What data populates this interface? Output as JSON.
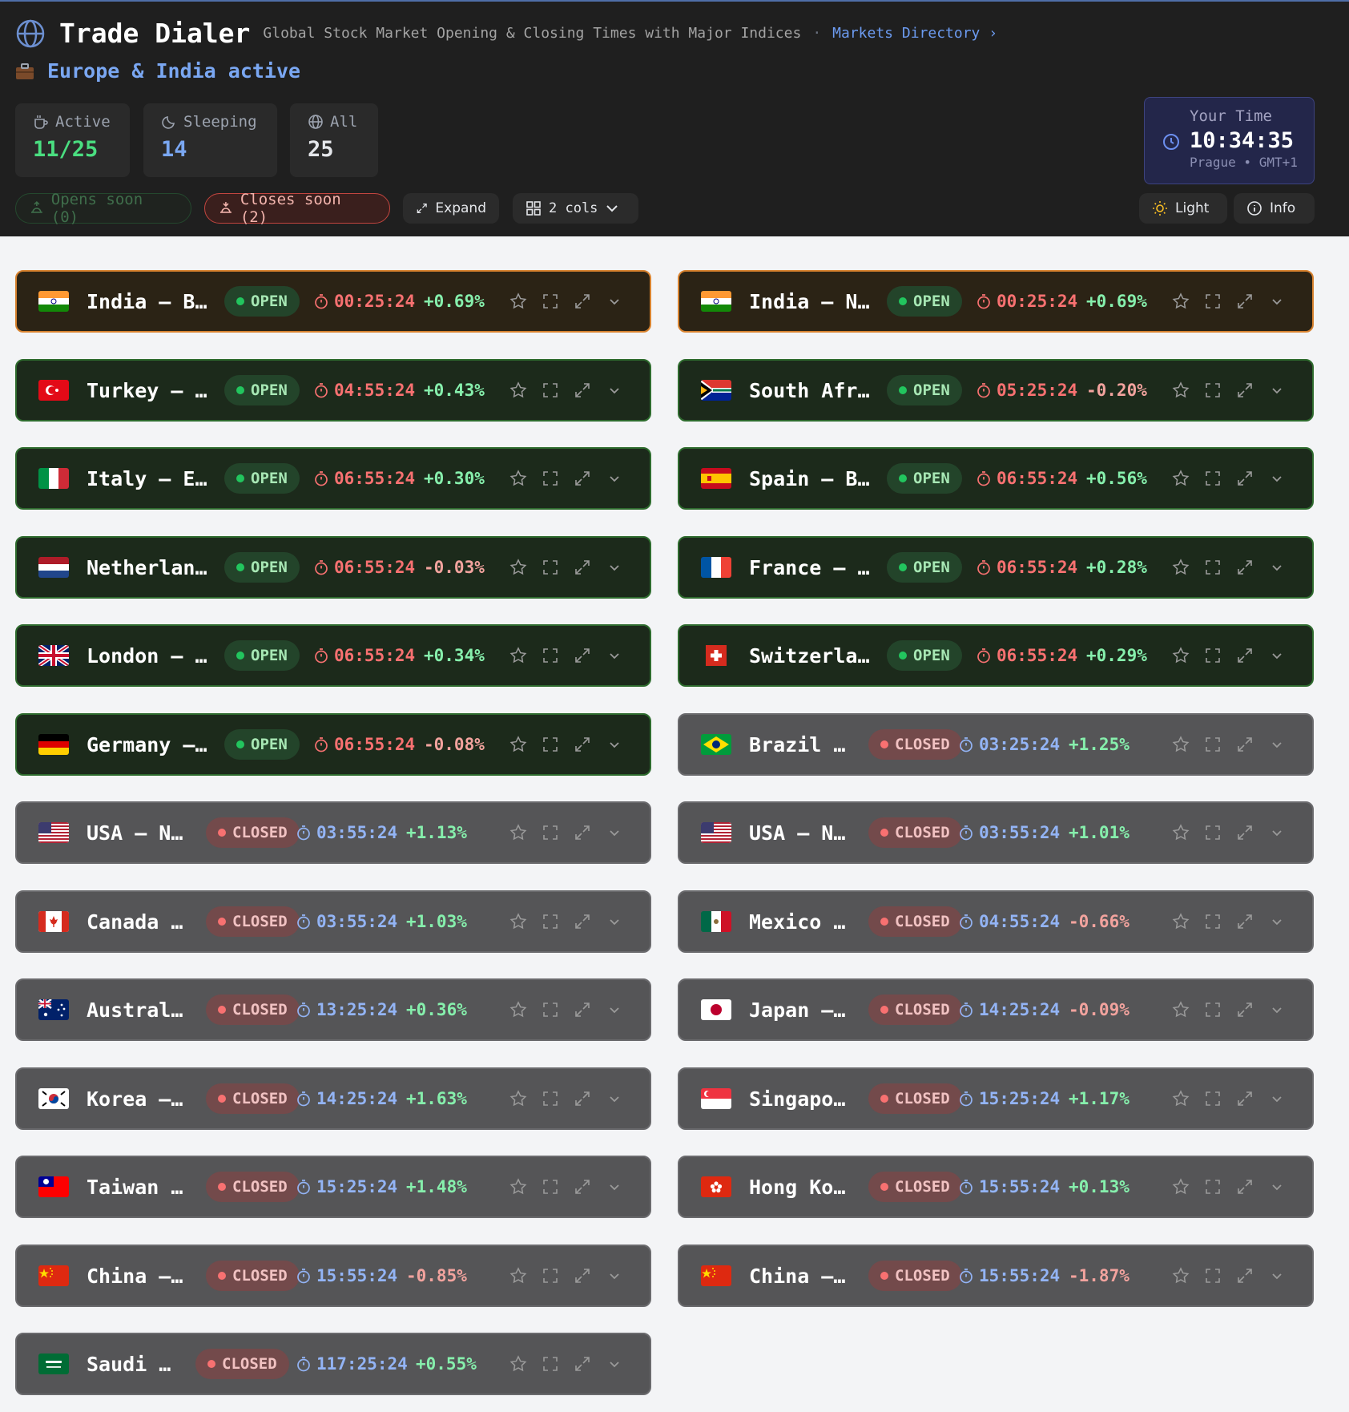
{
  "header": {
    "brand": "Trade Dialer",
    "subtitle": "Global Stock Market Opening & Closing Times with Major Indices",
    "separator": "·",
    "directory_link": "Markets Directory ›",
    "active_regions": "Europe & India active"
  },
  "stats": {
    "active": {
      "label": "Active",
      "value": "11/25"
    },
    "sleeping": {
      "label": "Sleeping",
      "value": "14"
    },
    "all": {
      "label": "All",
      "value": "25"
    }
  },
  "your_time": {
    "label": "Your Time",
    "time": "10:34:35",
    "zone": "Prague • GMT+1"
  },
  "filters": {
    "opens_soon": "Opens soon (0)",
    "closes_soon": "Closes soon (2)"
  },
  "controls": {
    "expand": "Expand",
    "columns": "2 cols",
    "theme": "Light",
    "info": "Info"
  },
  "colors": {
    "open": "#22c55e",
    "closed": "#f87171",
    "accent": "#7aa7f2",
    "closes_soon_border": "#d7822f"
  },
  "markets": [
    {
      "name": "India – B…",
      "flag": "india",
      "status": "OPEN",
      "timer": "00:25:24",
      "change": "+0.69%",
      "soon": true
    },
    {
      "name": "India – N…",
      "flag": "india",
      "status": "OPEN",
      "timer": "00:25:24",
      "change": "+0.69%",
      "soon": true
    },
    {
      "name": "Turkey – …",
      "flag": "turkey",
      "status": "OPEN",
      "timer": "04:55:24",
      "change": "+0.43%"
    },
    {
      "name": "South Afr…",
      "flag": "southafrica",
      "status": "OPEN",
      "timer": "05:25:24",
      "change": "-0.20%"
    },
    {
      "name": "Italy – E…",
      "flag": "italy",
      "status": "OPEN",
      "timer": "06:55:24",
      "change": "+0.30%"
    },
    {
      "name": "Spain – B…",
      "flag": "spain",
      "status": "OPEN",
      "timer": "06:55:24",
      "change": "+0.56%"
    },
    {
      "name": "Netherlan…",
      "flag": "netherlands",
      "status": "OPEN",
      "timer": "06:55:24",
      "change": "-0.03%"
    },
    {
      "name": "France – …",
      "flag": "france",
      "status": "OPEN",
      "timer": "06:55:24",
      "change": "+0.28%"
    },
    {
      "name": "London – …",
      "flag": "uk",
      "status": "OPEN",
      "timer": "06:55:24",
      "change": "+0.34%"
    },
    {
      "name": "Switzerla…",
      "flag": "switzerland",
      "status": "OPEN",
      "timer": "06:55:24",
      "change": "+0.29%"
    },
    {
      "name": "Germany –…",
      "flag": "germany",
      "status": "OPEN",
      "timer": "06:55:24",
      "change": "-0.08%"
    },
    {
      "name": "Brazil …",
      "flag": "brazil",
      "status": "CLOSED",
      "timer": "03:25:24",
      "change": "+1.25%"
    },
    {
      "name": "USA – N…",
      "flag": "usa",
      "status": "CLOSED",
      "timer": "03:55:24",
      "change": "+1.13%"
    },
    {
      "name": "USA – N…",
      "flag": "usa",
      "status": "CLOSED",
      "timer": "03:55:24",
      "change": "+1.01%"
    },
    {
      "name": "Canada …",
      "flag": "canada",
      "status": "CLOSED",
      "timer": "03:55:24",
      "change": "+1.03%"
    },
    {
      "name": "Mexico …",
      "flag": "mexico",
      "status": "CLOSED",
      "timer": "04:55:24",
      "change": "-0.66%"
    },
    {
      "name": "Austral…",
      "flag": "australia",
      "status": "CLOSED",
      "timer": "13:25:24",
      "change": "+0.36%"
    },
    {
      "name": "Japan –…",
      "flag": "japan",
      "status": "CLOSED",
      "timer": "14:25:24",
      "change": "-0.09%"
    },
    {
      "name": "Korea –…",
      "flag": "korea",
      "status": "CLOSED",
      "timer": "14:25:24",
      "change": "+1.63%"
    },
    {
      "name": "Singapo…",
      "flag": "singapore",
      "status": "CLOSED",
      "timer": "15:25:24",
      "change": "+1.17%"
    },
    {
      "name": "Taiwan …",
      "flag": "taiwan",
      "status": "CLOSED",
      "timer": "15:25:24",
      "change": "+1.48%"
    },
    {
      "name": "Hong Ko…",
      "flag": "hongkong",
      "status": "CLOSED",
      "timer": "15:55:24",
      "change": "+0.13%"
    },
    {
      "name": "China –…",
      "flag": "china",
      "status": "CLOSED",
      "timer": "15:55:24",
      "change": "-0.85%"
    },
    {
      "name": "China –…",
      "flag": "china",
      "status": "CLOSED",
      "timer": "15:55:24",
      "change": "-1.87%"
    },
    {
      "name": "Saudi …",
      "flag": "saudi",
      "status": "CLOSED",
      "timer": "117:25:24",
      "change": "+0.55%"
    }
  ]
}
